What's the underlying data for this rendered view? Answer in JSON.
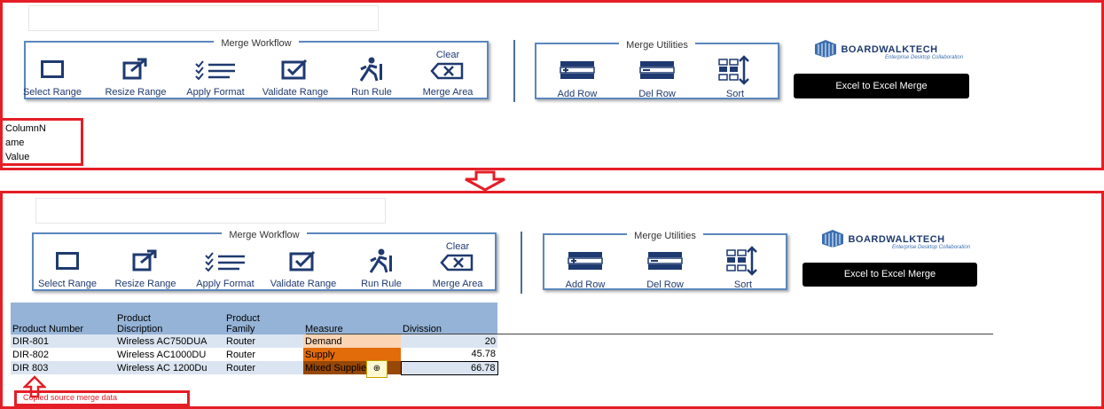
{
  "top": {
    "workflow": {
      "title": "Merge Workflow",
      "buttons": {
        "select_range": "Select Range",
        "resize_range": "Resize Range",
        "apply_format": "Apply Format",
        "validate_range": "Validate Range",
        "run_rule": "Run Rule",
        "clear_merge_area_top": "Clear",
        "clear_merge_area_bottom": "Merge Area"
      }
    },
    "utilities": {
      "title": "Merge Utilities",
      "buttons": {
        "add_row": "Add Row",
        "del_row": "Del Row",
        "sort": "Sort"
      }
    },
    "logo": {
      "name": "BOARDWALKTECH",
      "tagline": "Enterprise Desktop Collaboration"
    },
    "excel_merge_button": "Excel to Excel Merge",
    "cells": [
      "ColumnN",
      "ame",
      "Value"
    ]
  },
  "bottom": {
    "workflow": {
      "title": "Merge Workflow",
      "buttons": {
        "select_range": "Select Range",
        "resize_range": "Resize Range",
        "apply_format": "Apply Format",
        "validate_range": "Validate Range",
        "run_rule": "Run Rule",
        "clear_merge_area_top": "Clear",
        "clear_merge_area_bottom": "Merge Area"
      }
    },
    "utilities": {
      "title": "Merge Utilities",
      "buttons": {
        "add_row": "Add Row",
        "del_row": "Del Row",
        "sort": "Sort"
      }
    },
    "logo": {
      "name": "BOARDWALKTECH",
      "tagline": "Enterprise Desktop Collaboration"
    },
    "excel_merge_button": "Excel to Excel Merge",
    "table": {
      "headers": [
        [
          "",
          "Product Number"
        ],
        [
          "Product",
          "Discription"
        ],
        [
          "Product",
          "Family"
        ],
        [
          "",
          "Measure"
        ],
        [
          "",
          "Divission"
        ]
      ],
      "rows": [
        [
          "DIR-801",
          "Wireless AC750DUA",
          "Router",
          "Demand",
          "20"
        ],
        [
          "DIR-802",
          "Wireless AC1000DU",
          "Router",
          "Supply",
          "45.78"
        ],
        [
          "DIR 803",
          "Wireless AC 1200Du",
          "Router",
          "Mixed Supplied",
          "66.78"
        ]
      ]
    },
    "caption": "Copied source merge data"
  },
  "colors": {
    "highlight_red": "#e41e26",
    "table_header": "#95b3d7",
    "demand": "#fcd5b4",
    "supply": "#e26b0a",
    "mixed": "#974706",
    "brand_blue": "#1f3a70"
  }
}
